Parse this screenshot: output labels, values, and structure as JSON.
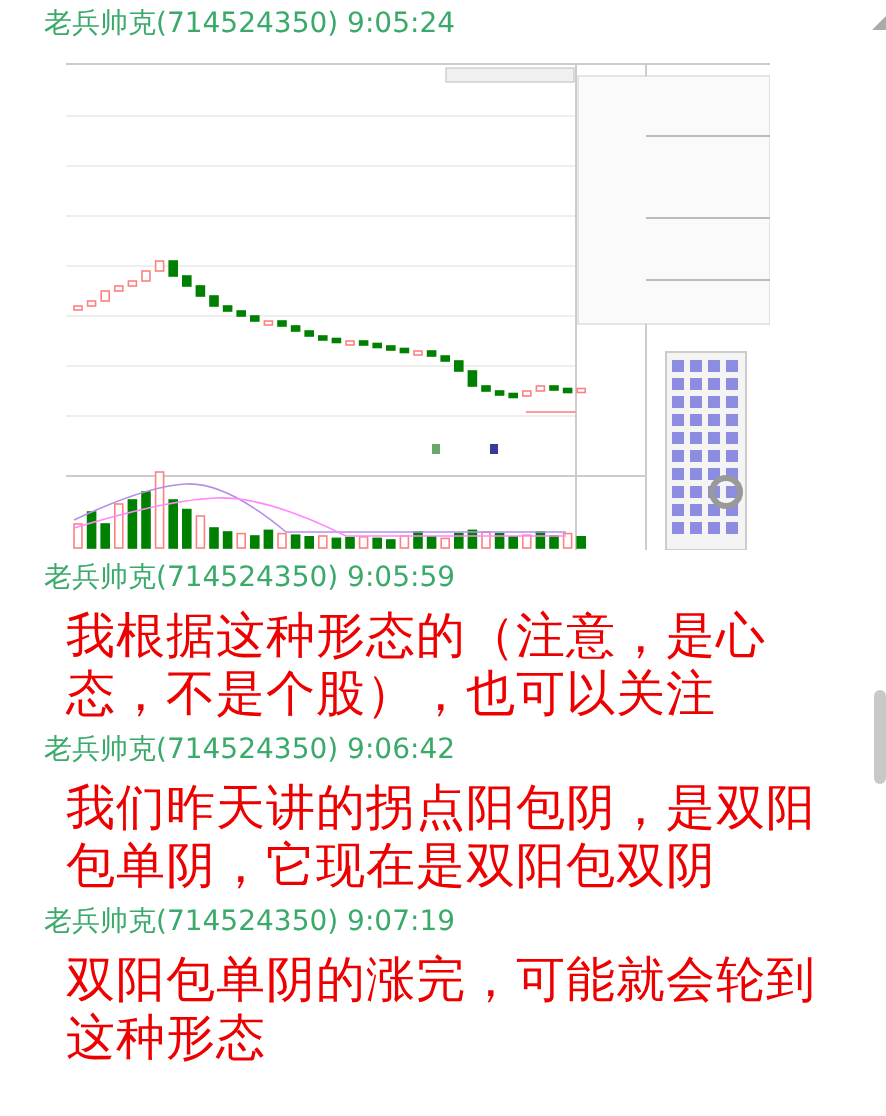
{
  "messages": [
    {
      "header": "老兵帅克(714524350) 9:05:24",
      "kind": "image"
    },
    {
      "header": "老兵帅克(714524350) 9:05:59",
      "kind": "text",
      "text": "我根据这种形态的（注意，是心态，不是个股），也可以关注"
    },
    {
      "header": "老兵帅克(714524350) 9:06:42",
      "kind": "text",
      "text": "我们昨天讲的拐点阳包阴，是双阳包单阴，它现在是双阳包双阴"
    },
    {
      "header": "老兵帅克(714524350) 9:07:19",
      "kind": "text",
      "text": "双阳包单阴的涨完，可能就会轮到这种形态"
    }
  ]
}
